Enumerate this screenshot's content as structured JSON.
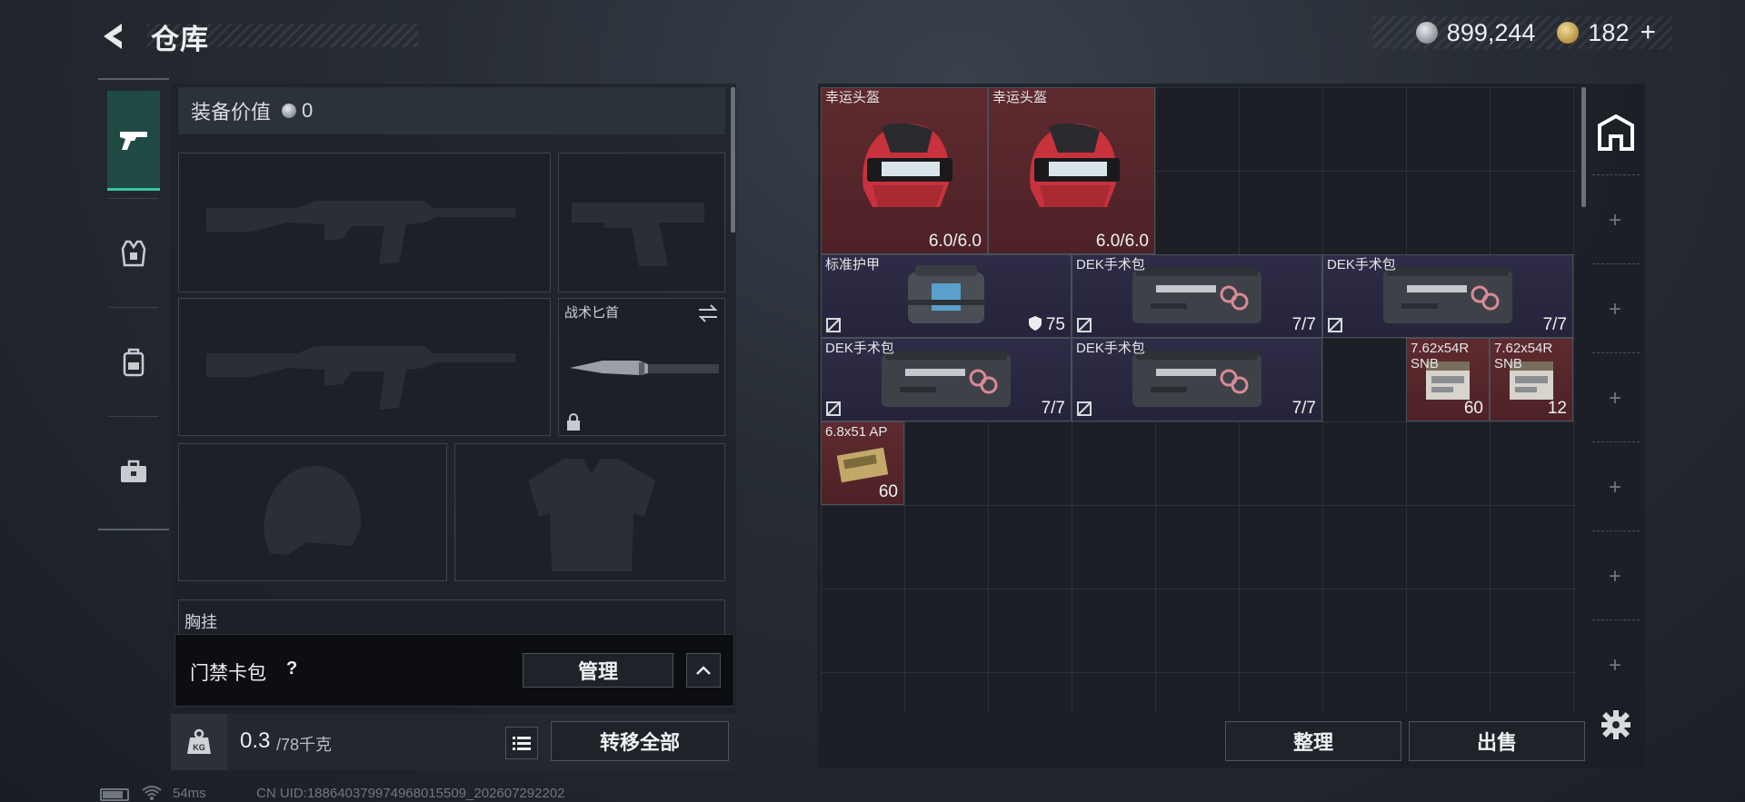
{
  "header": {
    "title": "仓库",
    "silver_value": "899,244",
    "gold_value": "182",
    "gold_plus": "+"
  },
  "left_panel": {
    "equip_value_label": "装备价值",
    "equip_value": "0",
    "knife_slot_label": "战术匕首",
    "next_section_label": "胸挂",
    "keycard": {
      "label": "门禁卡包",
      "help": "?",
      "manage_label": "管理"
    },
    "weight": {
      "value": "0.3",
      "max": "/78千克"
    },
    "transfer_all_label": "转移全部"
  },
  "inventory": {
    "items": [
      {
        "name": "幸运头盔",
        "count": "6.0/6.0",
        "rarity": "red"
      },
      {
        "name": "幸运头盔",
        "count": "6.0/6.0",
        "rarity": "red"
      },
      {
        "name": "标准护甲",
        "count": "75",
        "rarity": "purple"
      },
      {
        "name": "DEK手术包",
        "count": "7/7",
        "rarity": "purple"
      },
      {
        "name": "DEK手术包",
        "count": "7/7",
        "rarity": "purple"
      },
      {
        "name": "DEK手术包",
        "count": "7/7",
        "rarity": "purple"
      },
      {
        "name": "DEK手术包",
        "count": "7/7",
        "rarity": "purple"
      },
      {
        "name": "7.62x54R SNB",
        "count": "60",
        "rarity": "red"
      },
      {
        "name": "7.62x54R SNB",
        "count": "12",
        "rarity": "red"
      },
      {
        "name": "6.8x51 AP",
        "count": "60",
        "rarity": "red"
      }
    ],
    "sort_label": "整理",
    "sell_label": "出售"
  },
  "status_bar": {
    "ping": "54ms",
    "uid": "CN UID:1886403799749​68015509_202607292202"
  },
  "colors": {
    "accent": "#3ac5a0",
    "red_item": "#5e2a2f",
    "purple_item": "#2e2c46"
  }
}
